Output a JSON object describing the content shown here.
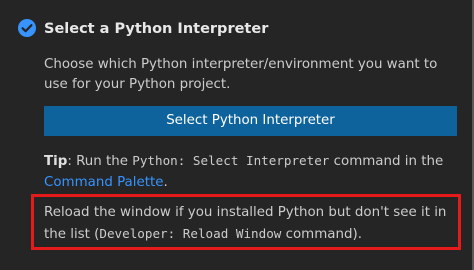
{
  "step": {
    "title": "Select a Python Interpreter",
    "status_icon": "check-circle-icon",
    "description": "Choose which Python interpreter/environment you want to use for your Python project.",
    "button_label": "Select Python Interpreter"
  },
  "tip": {
    "label": "Tip",
    "colon": ":",
    "text_before": " Run the ",
    "command": "Python: Select Interpreter",
    "text_middle": " command in the ",
    "link": "Command Palette",
    "text_after": "."
  },
  "reload": {
    "text_before": "Reload the window if you installed Python but don't see it in the list (",
    "command": "Developer: Reload Window",
    "text_after": " command)."
  },
  "colors": {
    "panel_background": "#252526",
    "button": "#0e639c",
    "link": "#3794ff",
    "check": "#3794ff",
    "highlight_border": "#e51a1a"
  }
}
